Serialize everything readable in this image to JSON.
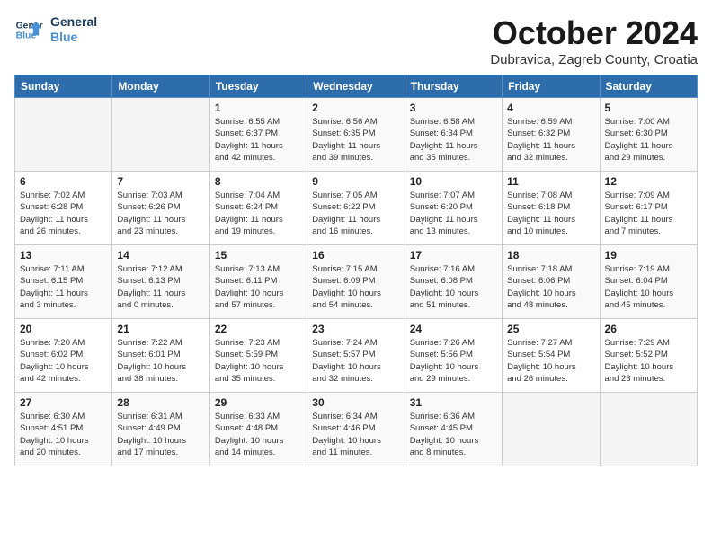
{
  "logo": {
    "line1": "General",
    "line2": "Blue"
  },
  "title": "October 2024",
  "subtitle": "Dubravica, Zagreb County, Croatia",
  "weekdays": [
    "Sunday",
    "Monday",
    "Tuesday",
    "Wednesday",
    "Thursday",
    "Friday",
    "Saturday"
  ],
  "weeks": [
    [
      {
        "day": "",
        "info": ""
      },
      {
        "day": "",
        "info": ""
      },
      {
        "day": "1",
        "info": "Sunrise: 6:55 AM\nSunset: 6:37 PM\nDaylight: 11 hours\nand 42 minutes."
      },
      {
        "day": "2",
        "info": "Sunrise: 6:56 AM\nSunset: 6:35 PM\nDaylight: 11 hours\nand 39 minutes."
      },
      {
        "day": "3",
        "info": "Sunrise: 6:58 AM\nSunset: 6:34 PM\nDaylight: 11 hours\nand 35 minutes."
      },
      {
        "day": "4",
        "info": "Sunrise: 6:59 AM\nSunset: 6:32 PM\nDaylight: 11 hours\nand 32 minutes."
      },
      {
        "day": "5",
        "info": "Sunrise: 7:00 AM\nSunset: 6:30 PM\nDaylight: 11 hours\nand 29 minutes."
      }
    ],
    [
      {
        "day": "6",
        "info": "Sunrise: 7:02 AM\nSunset: 6:28 PM\nDaylight: 11 hours\nand 26 minutes."
      },
      {
        "day": "7",
        "info": "Sunrise: 7:03 AM\nSunset: 6:26 PM\nDaylight: 11 hours\nand 23 minutes."
      },
      {
        "day": "8",
        "info": "Sunrise: 7:04 AM\nSunset: 6:24 PM\nDaylight: 11 hours\nand 19 minutes."
      },
      {
        "day": "9",
        "info": "Sunrise: 7:05 AM\nSunset: 6:22 PM\nDaylight: 11 hours\nand 16 minutes."
      },
      {
        "day": "10",
        "info": "Sunrise: 7:07 AM\nSunset: 6:20 PM\nDaylight: 11 hours\nand 13 minutes."
      },
      {
        "day": "11",
        "info": "Sunrise: 7:08 AM\nSunset: 6:18 PM\nDaylight: 11 hours\nand 10 minutes."
      },
      {
        "day": "12",
        "info": "Sunrise: 7:09 AM\nSunset: 6:17 PM\nDaylight: 11 hours\nand 7 minutes."
      }
    ],
    [
      {
        "day": "13",
        "info": "Sunrise: 7:11 AM\nSunset: 6:15 PM\nDaylight: 11 hours\nand 3 minutes."
      },
      {
        "day": "14",
        "info": "Sunrise: 7:12 AM\nSunset: 6:13 PM\nDaylight: 11 hours\nand 0 minutes."
      },
      {
        "day": "15",
        "info": "Sunrise: 7:13 AM\nSunset: 6:11 PM\nDaylight: 10 hours\nand 57 minutes."
      },
      {
        "day": "16",
        "info": "Sunrise: 7:15 AM\nSunset: 6:09 PM\nDaylight: 10 hours\nand 54 minutes."
      },
      {
        "day": "17",
        "info": "Sunrise: 7:16 AM\nSunset: 6:08 PM\nDaylight: 10 hours\nand 51 minutes."
      },
      {
        "day": "18",
        "info": "Sunrise: 7:18 AM\nSunset: 6:06 PM\nDaylight: 10 hours\nand 48 minutes."
      },
      {
        "day": "19",
        "info": "Sunrise: 7:19 AM\nSunset: 6:04 PM\nDaylight: 10 hours\nand 45 minutes."
      }
    ],
    [
      {
        "day": "20",
        "info": "Sunrise: 7:20 AM\nSunset: 6:02 PM\nDaylight: 10 hours\nand 42 minutes."
      },
      {
        "day": "21",
        "info": "Sunrise: 7:22 AM\nSunset: 6:01 PM\nDaylight: 10 hours\nand 38 minutes."
      },
      {
        "day": "22",
        "info": "Sunrise: 7:23 AM\nSunset: 5:59 PM\nDaylight: 10 hours\nand 35 minutes."
      },
      {
        "day": "23",
        "info": "Sunrise: 7:24 AM\nSunset: 5:57 PM\nDaylight: 10 hours\nand 32 minutes."
      },
      {
        "day": "24",
        "info": "Sunrise: 7:26 AM\nSunset: 5:56 PM\nDaylight: 10 hours\nand 29 minutes."
      },
      {
        "day": "25",
        "info": "Sunrise: 7:27 AM\nSunset: 5:54 PM\nDaylight: 10 hours\nand 26 minutes."
      },
      {
        "day": "26",
        "info": "Sunrise: 7:29 AM\nSunset: 5:52 PM\nDaylight: 10 hours\nand 23 minutes."
      }
    ],
    [
      {
        "day": "27",
        "info": "Sunrise: 6:30 AM\nSunset: 4:51 PM\nDaylight: 10 hours\nand 20 minutes."
      },
      {
        "day": "28",
        "info": "Sunrise: 6:31 AM\nSunset: 4:49 PM\nDaylight: 10 hours\nand 17 minutes."
      },
      {
        "day": "29",
        "info": "Sunrise: 6:33 AM\nSunset: 4:48 PM\nDaylight: 10 hours\nand 14 minutes."
      },
      {
        "day": "30",
        "info": "Sunrise: 6:34 AM\nSunset: 4:46 PM\nDaylight: 10 hours\nand 11 minutes."
      },
      {
        "day": "31",
        "info": "Sunrise: 6:36 AM\nSunset: 4:45 PM\nDaylight: 10 hours\nand 8 minutes."
      },
      {
        "day": "",
        "info": ""
      },
      {
        "day": "",
        "info": ""
      }
    ]
  ]
}
